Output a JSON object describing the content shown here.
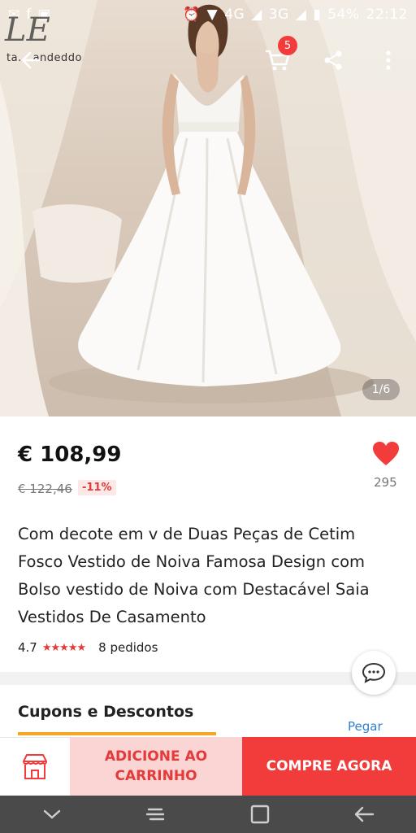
{
  "status_bar": {
    "time": "22:12",
    "battery": "54%",
    "network_1": "4G",
    "network_2": "3G"
  },
  "header": {
    "logo": "LE",
    "logo_sub": "ta... andeddo",
    "cart_count": "5"
  },
  "gallery": {
    "counter": "1/6"
  },
  "product": {
    "price": "€ 108,99",
    "old_price": "€ 122,46",
    "discount": "-11%",
    "likes": "295",
    "title": "Com decote em v de Duas Peças de Cetim Fosco Vestido de Noiva Famosa Design com Bolso vestido de Noiva com Destacável Saia Vestidos De Casamento",
    "rating": "4.7",
    "stars": "★★★★★",
    "orders": "8 pedidos"
  },
  "coupons": {
    "title": "Cupons e Descontos",
    "action": "Pegar"
  },
  "actions": {
    "add_to_cart": "ADICIONE AO CARRINHO",
    "buy_now": "COMPRE AGORA"
  },
  "colors": {
    "accent": "#f23c3c",
    "accent_light": "#fbd4d4",
    "coupon_bar": "#f5a623",
    "link": "#2f7fd1"
  }
}
